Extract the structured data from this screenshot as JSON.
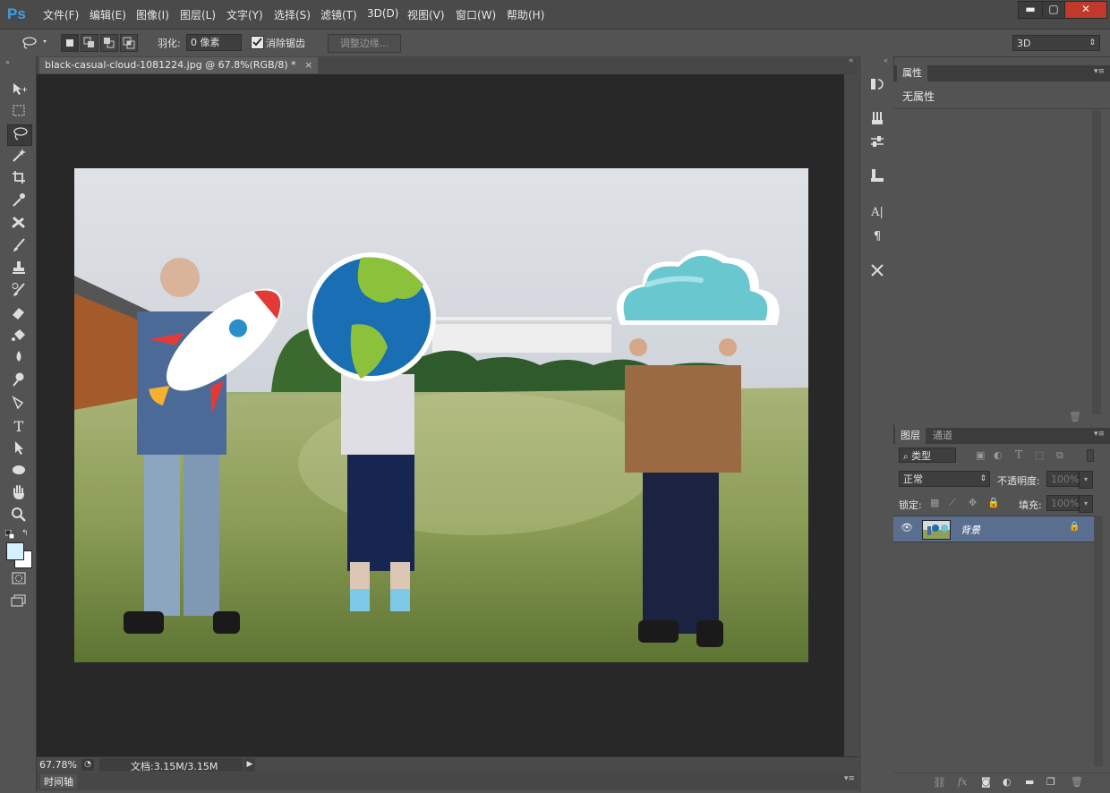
{
  "app": {
    "logo": "Ps"
  },
  "menu": {
    "items": [
      "文件(F)",
      "编辑(E)",
      "图像(I)",
      "图层(L)",
      "文字(Y)",
      "选择(S)",
      "滤镜(T)",
      "3D(D)",
      "视图(V)",
      "窗口(W)",
      "帮助(H)"
    ]
  },
  "window_controls": {
    "minimize": "▬",
    "maximize": "▢",
    "close": "✕"
  },
  "options_bar": {
    "feather_label": "羽化:",
    "feather_value": "0 像素",
    "antialias_label": "消除锯齿",
    "refine_edge_label": "调整边缘...",
    "workspace_value": "3D"
  },
  "document": {
    "tab_title": "black-casual-cloud-1081224.jpg @ 67.8%(RGB/8) *",
    "tab_close": "×",
    "zoom": "67.78%",
    "doc_info": "文档:3.15M/3.15M"
  },
  "timeline": {
    "label": "时间轴"
  },
  "properties_panel": {
    "tab": "属性",
    "content": "无属性"
  },
  "layers_panel": {
    "tabs": [
      "图层",
      "通道"
    ],
    "filter_kind": "类型",
    "blend_mode": "正常",
    "opacity_label": "不透明度:",
    "opacity_value": "100%",
    "lock_label": "锁定:",
    "fill_label": "填充:",
    "fill_value": "100%",
    "layers": [
      {
        "name": "背景",
        "visible": true,
        "locked": true
      }
    ]
  },
  "colors": {
    "accent": "#3aa0e8",
    "selected_layer": "#5a6f8f",
    "canvas_bg": "#282828"
  },
  "icons": [
    "move-tool",
    "marquee-tool",
    "lasso-tool",
    "magic-wand-tool",
    "crop-tool",
    "eyedropper-tool",
    "healing-tool",
    "brush-tool",
    "stamp-tool",
    "history-brush-tool",
    "eraser-tool",
    "paint-bucket-tool",
    "blur-tool",
    "dodge-tool",
    "pen-tool",
    "type-tool",
    "path-selection-tool",
    "ellipse-tool",
    "hand-tool",
    "zoom-tool"
  ]
}
